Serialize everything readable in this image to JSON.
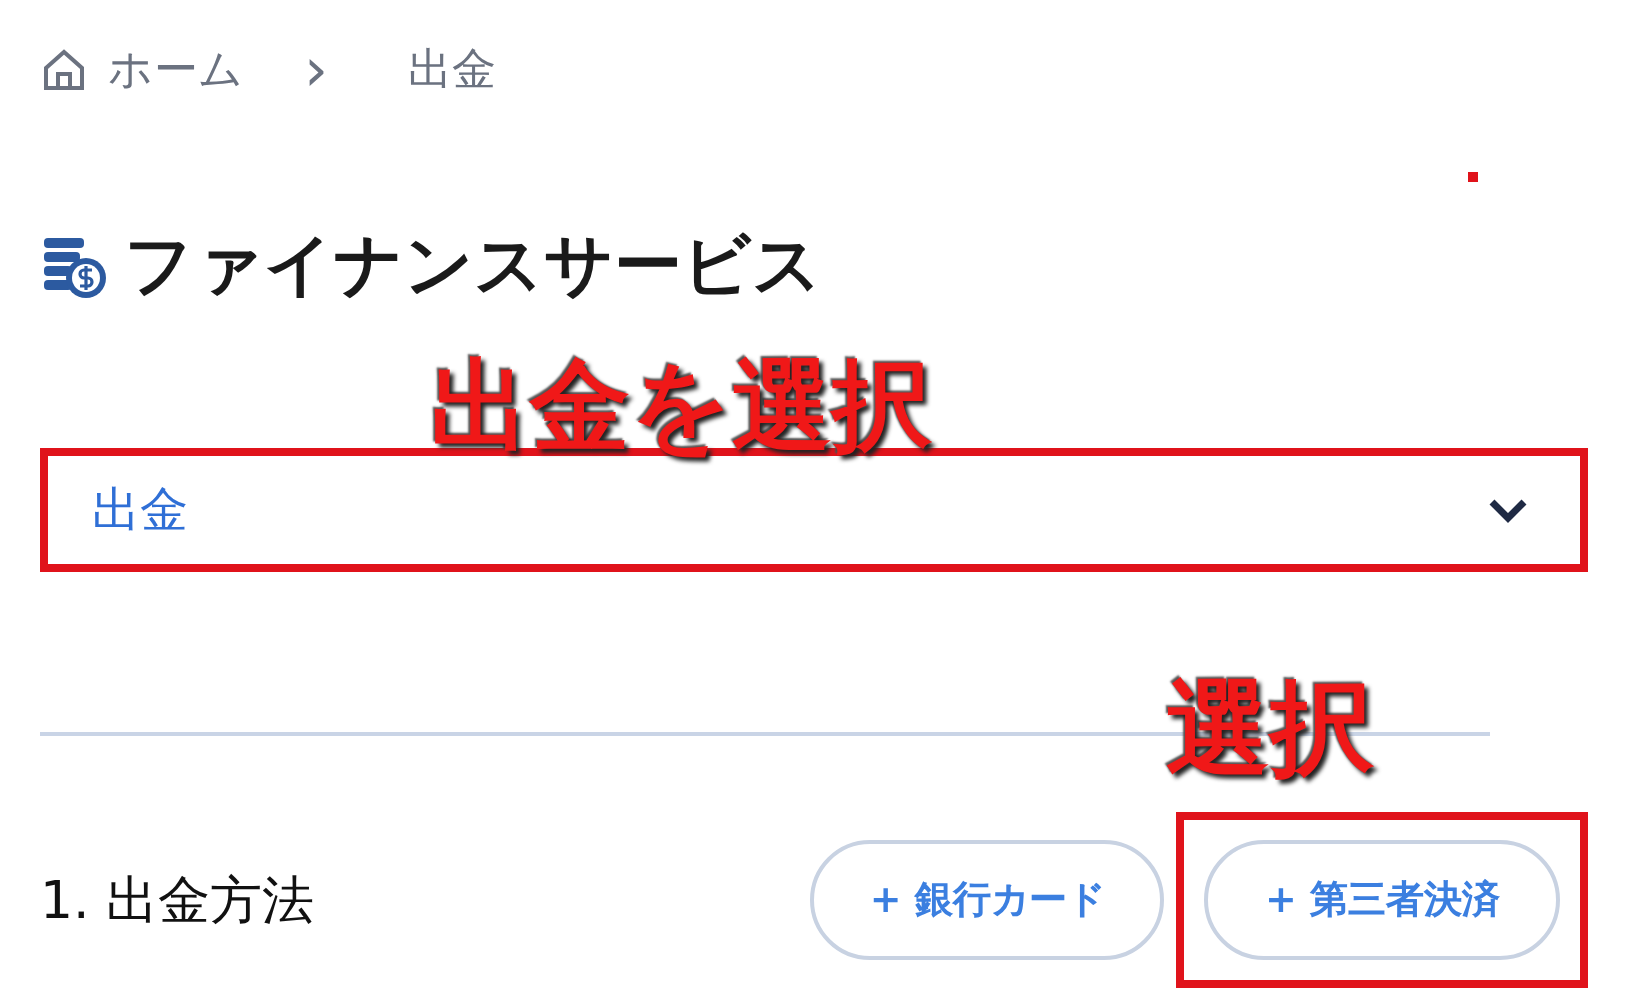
{
  "breadcrumb": {
    "home": "ホーム",
    "separator": "›",
    "current": "出金"
  },
  "title": "ファイナンスサービス",
  "dropdown": {
    "value": "出金",
    "highlighted": true
  },
  "section": {
    "label": "1. 出金方法",
    "buttons": [
      {
        "label": "+ 銀行カード",
        "highlighted": false
      },
      {
        "label": "+ 第三者決済",
        "highlighted": true
      }
    ]
  },
  "annotations": [
    {
      "text": "出金を選択"
    },
    {
      "text": "選択"
    }
  ]
}
